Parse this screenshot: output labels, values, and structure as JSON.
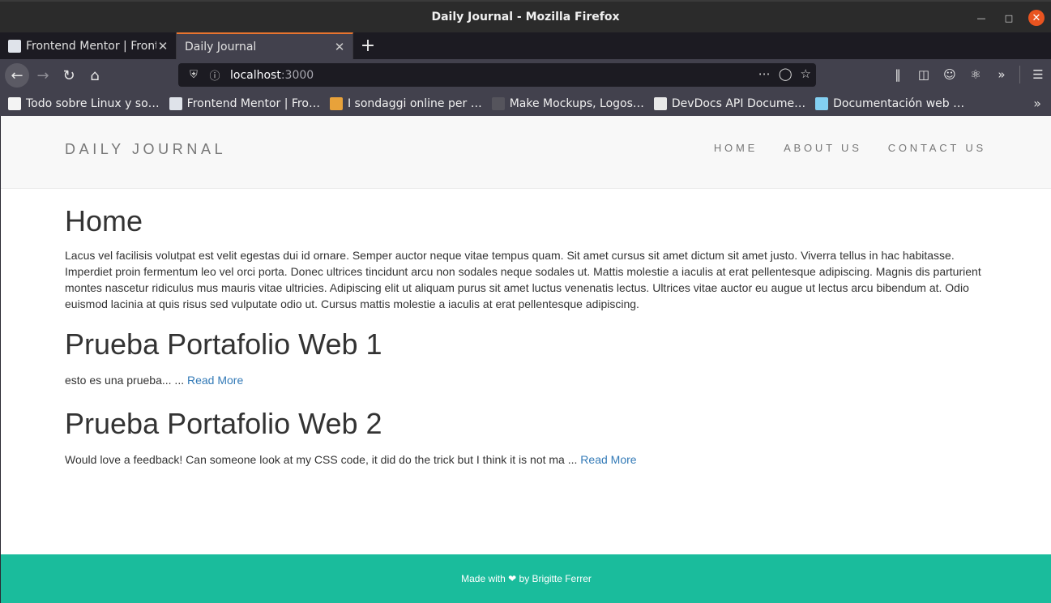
{
  "window": {
    "title": "Daily Journal - Mozilla Firefox"
  },
  "tabs": [
    {
      "label": "Frontend Mentor | Front",
      "active": false
    },
    {
      "label": "Daily Journal",
      "active": true
    }
  ],
  "url": {
    "host": "localhost",
    "port": ":3000"
  },
  "bookmarks": [
    {
      "label": "Todo sobre Linux y so…",
      "icon": "linux-icon",
      "color": "#f4f4f4"
    },
    {
      "label": "Frontend Mentor | Fro…",
      "icon": "frontend-mentor-icon",
      "color": "#dfe3ea"
    },
    {
      "label": "I sondaggi online per …",
      "icon": "survey-icon",
      "color": "#e8a23a"
    },
    {
      "label": "Make Mockups, Logos…",
      "icon": "placeit-icon",
      "color": "#55545c"
    },
    {
      "label": "DevDocs API Docume…",
      "icon": "devdocs-icon",
      "color": "#e8e8e8"
    },
    {
      "label": "Documentación web …",
      "icon": "mdn-icon",
      "color": "#83d0f2"
    }
  ],
  "site": {
    "brand": "DAILY JOURNAL",
    "nav": [
      "HOME",
      "ABOUT US",
      "CONTACT US"
    ],
    "heading": "Home",
    "intro": "Lacus vel facilisis volutpat est velit egestas dui id ornare. Semper auctor neque vitae tempus quam. Sit amet cursus sit amet dictum sit amet justo. Viverra tellus in hac habitasse. Imperdiet proin fermentum leo vel orci porta. Donec ultrices tincidunt arcu non sodales neque sodales ut. Mattis molestie a iaculis at erat pellentesque adipiscing. Magnis dis parturient montes nascetur ridiculus mus mauris vitae ultricies. Adipiscing elit ut aliquam purus sit amet luctus venenatis lectus. Ultrices vitae auctor eu augue ut lectus arcu bibendum at. Odio euismod lacinia at quis risus sed vulputate odio ut. Cursus mattis molestie a iaculis at erat pellentesque adipiscing.",
    "posts": [
      {
        "title": "Prueba Portafolio Web 1",
        "excerpt": "esto es una prueba... ... ",
        "link": "Read More"
      },
      {
        "title": "Prueba Portafolio Web 2",
        "excerpt": "Would love a feedback! Can someone look at my CSS code, it did do the trick but I think it is not ma ... ",
        "link": "Read More"
      }
    ],
    "footer": "Made with ❤ by Brigitte Ferrer"
  },
  "colors": {
    "footer_bg": "#1abc9c",
    "link": "#337ab7",
    "close_button": "#e95420",
    "active_tab_accent": "#e8742f"
  }
}
